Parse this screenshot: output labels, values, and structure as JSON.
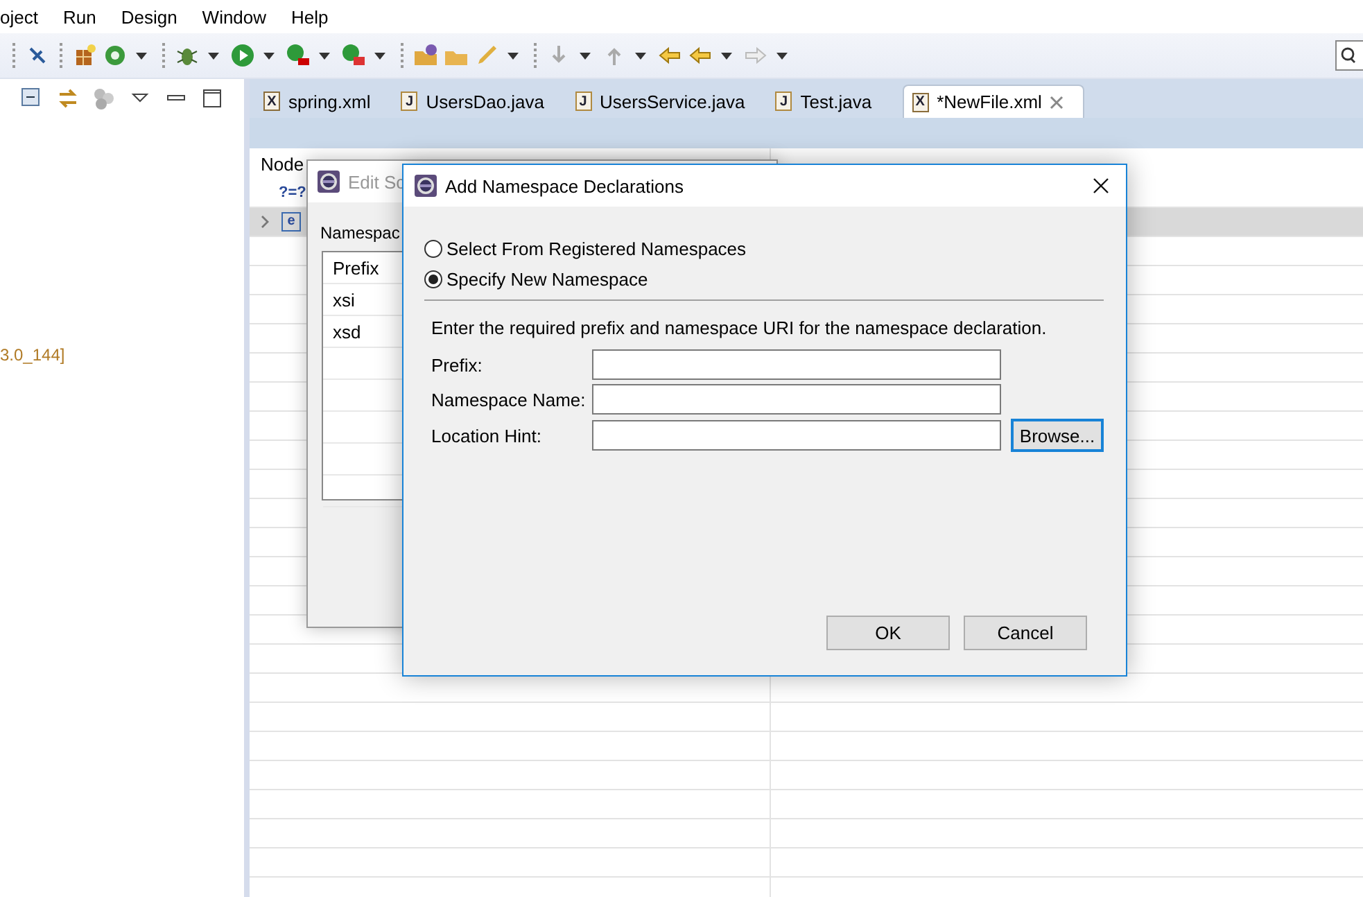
{
  "menu": [
    "oject",
    "Run",
    "Design",
    "Window",
    "Help"
  ],
  "left_panel": {
    "text": "3.0_144]"
  },
  "tabs": [
    {
      "label": "spring.xml",
      "kind": "xml",
      "badge": "X",
      "selected": false
    },
    {
      "label": "UsersDao.java",
      "kind": "java",
      "badge": "J",
      "selected": false
    },
    {
      "label": "UsersService.java",
      "kind": "java",
      "badge": "J",
      "selected": false
    },
    {
      "label": "Test.java",
      "kind": "java",
      "badge": "J",
      "selected": false
    },
    {
      "label": "*NewFile.xml",
      "kind": "xml",
      "badge": "X",
      "selected": true
    }
  ],
  "tree": {
    "column_1": "Node",
    "rows": [
      {
        "kind": "instruction",
        "label": "?=?",
        "selected": false
      },
      {
        "kind": "element",
        "label": "e",
        "selected": true
      }
    ]
  },
  "edit_dialog": {
    "title": "Edit Sc",
    "section_label": "Namespac",
    "list_header": "Prefix",
    "rows": [
      "xsi",
      "xsd"
    ]
  },
  "dialog": {
    "title": "Add Namespace Declarations",
    "options": [
      {
        "label": "Select From Registered Namespaces",
        "selected": false
      },
      {
        "label": "Specify New Namespace",
        "selected": true
      }
    ],
    "description": "Enter the required prefix and namespace URI for the namespace declaration.",
    "fields": [
      {
        "label": "Prefix:"
      },
      {
        "label": "Namespace Name:"
      },
      {
        "label": "Location Hint:",
        "action": "Browse..."
      }
    ],
    "buttons": [
      "OK",
      "Cancel"
    ]
  }
}
